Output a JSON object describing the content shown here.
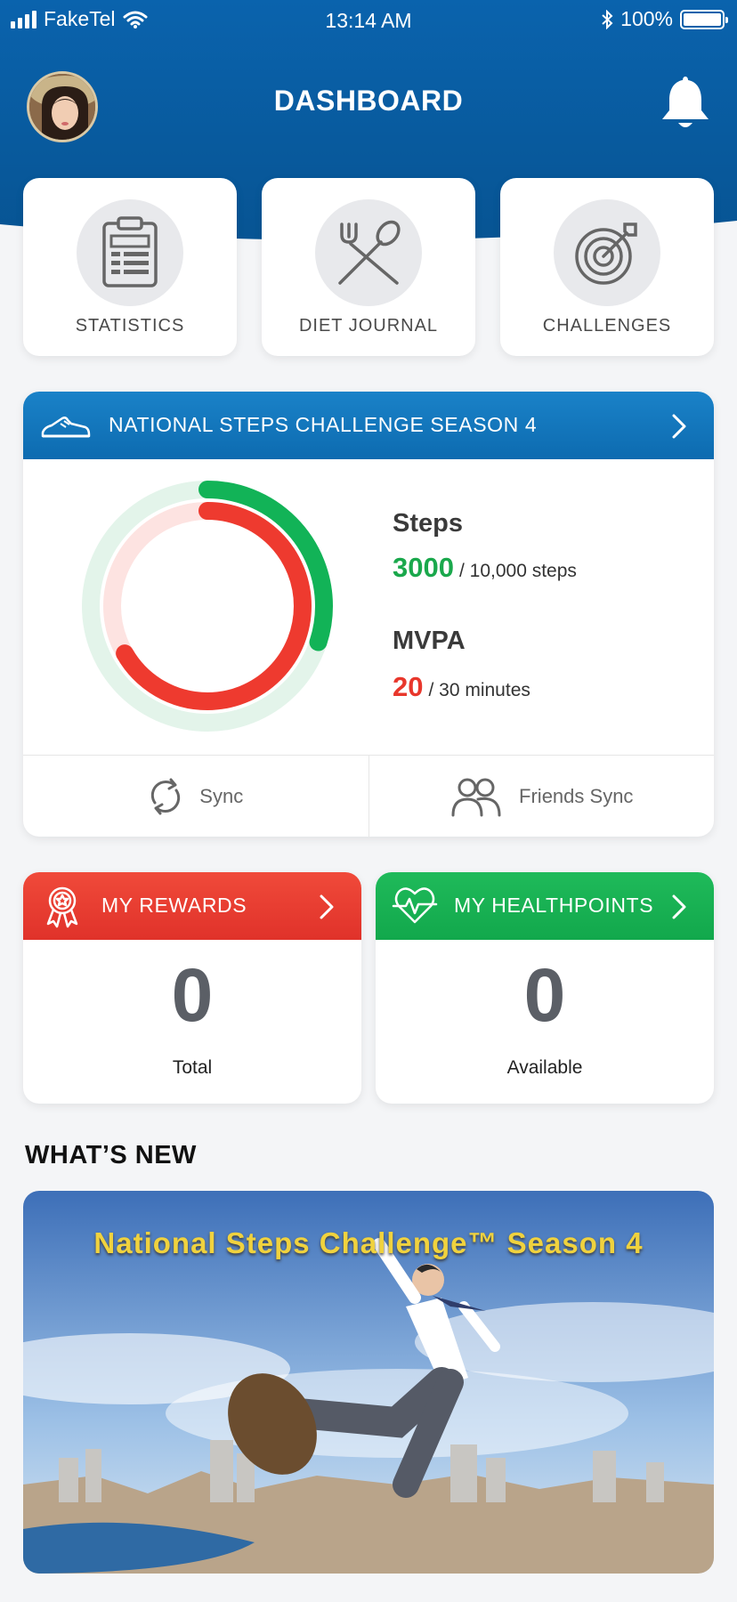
{
  "status_bar": {
    "carrier": "FakeTel",
    "time": "13:14 AM",
    "battery": "100%"
  },
  "header": {
    "title": "DASHBOARD"
  },
  "tiles": [
    {
      "label": "STATISTICS",
      "icon": "clipboard-icon"
    },
    {
      "label": "DIET JOURNAL",
      "icon": "fork-spoon-icon"
    },
    {
      "label": "CHALLENGES",
      "icon": "target-icon"
    }
  ],
  "challenge": {
    "title": "NATIONAL STEPS CHALLENGE SEASON 4",
    "steps": {
      "label": "Steps",
      "value": "3000",
      "target": "/ 10,000 steps",
      "progress": 0.3
    },
    "mvpa": {
      "label": "MVPA",
      "value": "20",
      "target": "/ 30 minutes",
      "progress": 0.667
    },
    "sync_label": "Sync",
    "friends_sync_label": "Friends Sync"
  },
  "rewards": {
    "title": "MY REWARDS",
    "value": "0",
    "caption": "Total"
  },
  "healthpoints": {
    "title": "MY HEALTHPOINTS",
    "value": "0",
    "caption": "Available"
  },
  "whats_new": {
    "title": "WHAT’S NEW",
    "banner_title": "National Steps Challenge™ Season 4"
  },
  "colors": {
    "header_blue": "#0b5fa5",
    "green": "#1aa84c",
    "red": "#e8372c"
  }
}
